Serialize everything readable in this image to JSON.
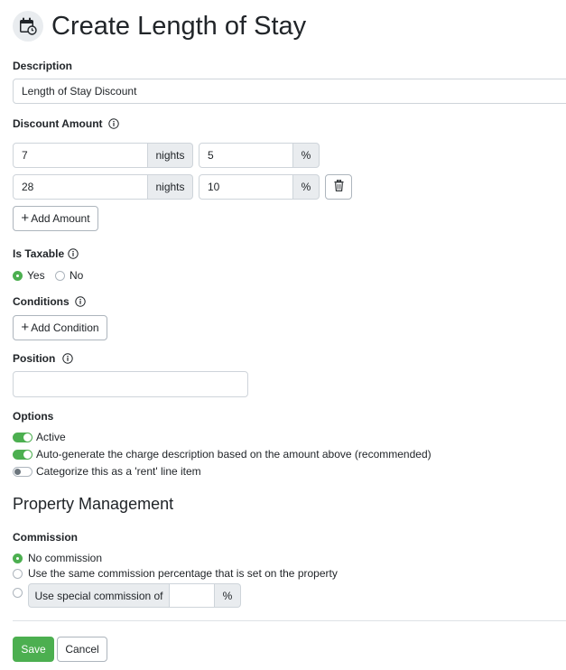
{
  "header": {
    "title": "Create Length of Stay",
    "icon": "calendar-clock-icon"
  },
  "description": {
    "label": "Description",
    "value": "Length of Stay Discount"
  },
  "discount_amount": {
    "label": "Discount Amount",
    "rows": [
      {
        "nights": "7",
        "nights_unit": "nights",
        "percent": "5",
        "percent_unit": "%"
      },
      {
        "nights": "28",
        "nights_unit": "nights",
        "percent": "10",
        "percent_unit": "%"
      }
    ],
    "add_label": "Add Amount"
  },
  "is_taxable": {
    "label": "Is Taxable",
    "yes_label": "Yes",
    "no_label": "No",
    "selected": "Yes"
  },
  "conditions": {
    "label": "Conditions",
    "add_label": "Add Condition"
  },
  "position": {
    "label": "Position",
    "value": ""
  },
  "options": {
    "label": "Options",
    "items": [
      {
        "label": "Active",
        "on": true
      },
      {
        "label": "Auto-generate the charge description based on the amount above (recommended)",
        "on": true
      },
      {
        "label": "Categorize this as a 'rent' line item",
        "on": false
      }
    ]
  },
  "property_management": {
    "title": "Property Management",
    "commission": {
      "label": "Commission",
      "options": [
        "No commission",
        "Use the same commission percentage that is set on the property"
      ],
      "special_label": "Use special commission of",
      "special_value": "",
      "special_unit": "%",
      "selected": "No commission"
    }
  },
  "footer": {
    "save_label": "Save",
    "cancel_label": "Cancel"
  },
  "colors": {
    "success": "#4caf50",
    "addon": "#e9ecef",
    "border": "#ced4da"
  }
}
